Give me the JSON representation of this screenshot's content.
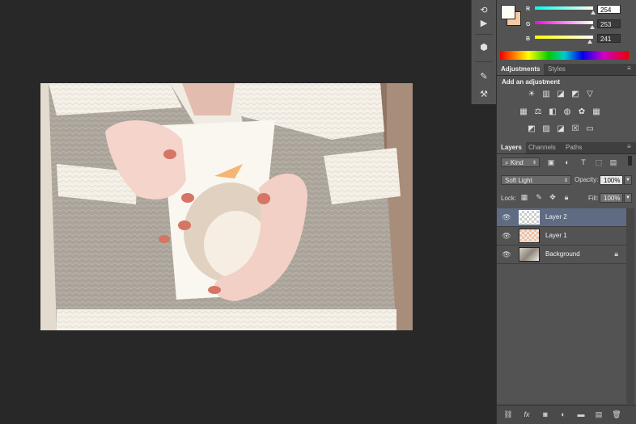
{
  "color_panel": {
    "r_label": "R",
    "g_label": "G",
    "b_label": "B",
    "r_value": "254",
    "g_value": "253",
    "b_value": "241",
    "foreground_color": "#fefdf1",
    "background_color": "#f6c9a2"
  },
  "adjustments_panel": {
    "tabs": [
      "Adjustments",
      "Styles"
    ],
    "heading": "Add an adjustment"
  },
  "layers_panel": {
    "tabs": [
      "Layers",
      "Channels",
      "Paths"
    ],
    "filter_kind": "Kind",
    "blend_mode": "Soft Light",
    "opacity_label": "Opacity:",
    "opacity_value": "100%",
    "lock_label": "Lock:",
    "fill_label": "Fill:",
    "fill_value": "100%",
    "layers": [
      {
        "name": "Layer 2",
        "selected": true
      },
      {
        "name": "Layer 1",
        "selected": false
      },
      {
        "name": "Background",
        "selected": false,
        "locked": true
      }
    ]
  },
  "icons": {
    "eye": "eye-icon",
    "lock": "lock-icon",
    "link": "link-icon",
    "fx": "fx-icon",
    "mask": "mask-icon",
    "adjustment": "adjustment-icon",
    "folder": "folder-icon",
    "new_layer": "new-layer-icon",
    "trash": "trash-icon"
  },
  "fx_label": "fx"
}
